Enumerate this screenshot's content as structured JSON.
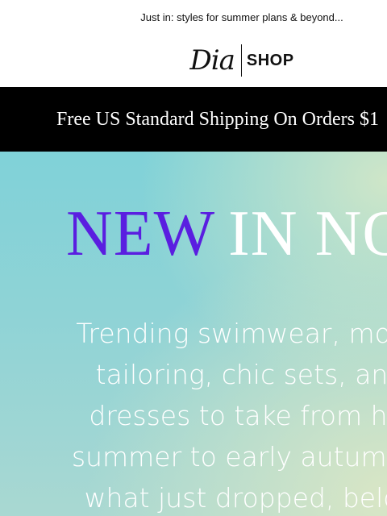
{
  "preheader": "Just in: styles for summer plans & beyond...",
  "logo": {
    "brand": "Dia",
    "section": "SHOP"
  },
  "shipping_banner": "Free US Standard Shipping On Orders $1",
  "hero": {
    "headline_accent": "NEW",
    "headline_rest": "IN NOW",
    "body_lines": [
      "Trending swimwear, mod",
      "tailoring, chic sets, an",
      "dresses to take from hi",
      "summer to early autumn.",
      "what just dropped, belo"
    ],
    "colors": {
      "accent": "#5a1ee0",
      "hero_bg": "#8fd3d6"
    }
  }
}
